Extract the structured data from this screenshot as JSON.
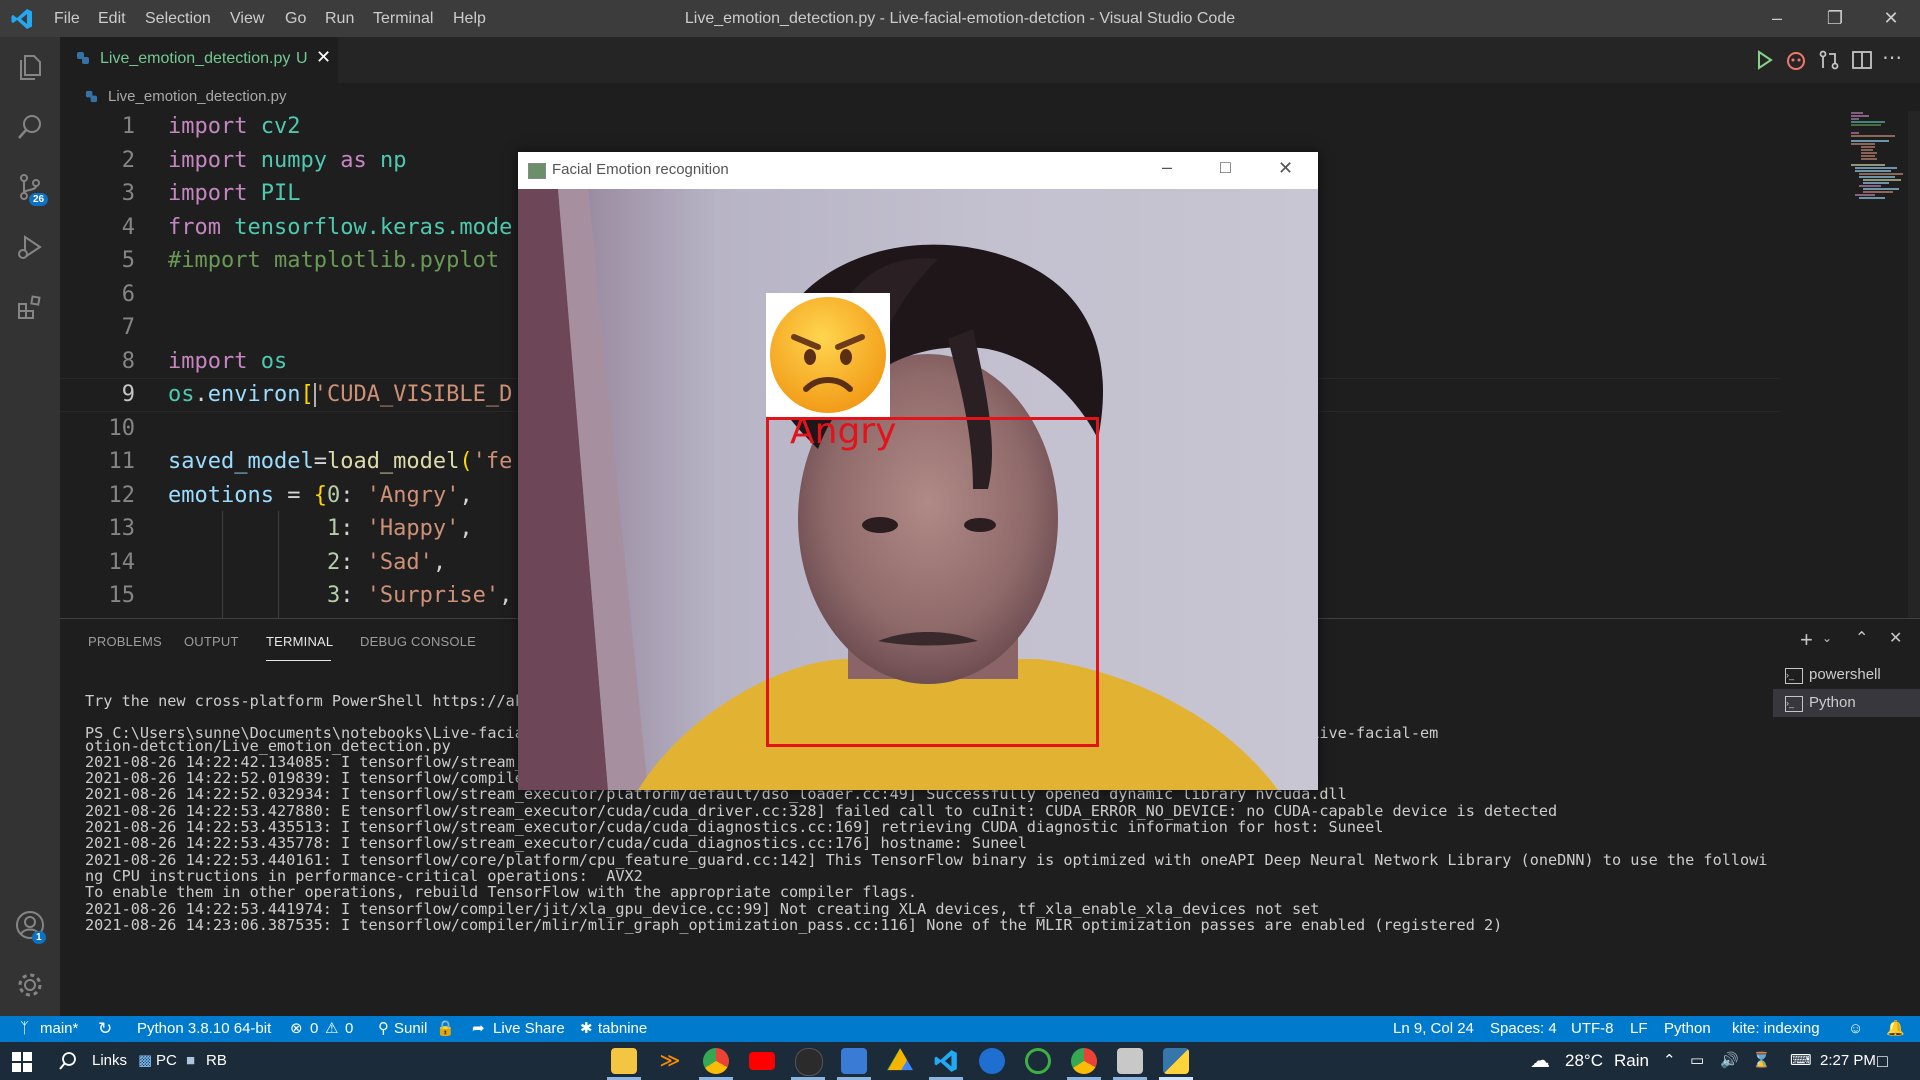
{
  "titlebar": {
    "menu": [
      "File",
      "Edit",
      "Selection",
      "View",
      "Go",
      "Run",
      "Terminal",
      "Help"
    ],
    "title": "Live_emotion_detection.py - Live-facial-emotion-detction - Visual Studio Code"
  },
  "activity": {
    "scm_badge": "26",
    "accounts_badge": "1"
  },
  "tab": {
    "filename": "Live_emotion_detection.py",
    "status": "U"
  },
  "breadcrumb": "Live_emotion_detection.py",
  "editor": {
    "lines": [
      "1",
      "2",
      "3",
      "4",
      "5",
      "6",
      "7",
      "8",
      "9",
      "10",
      "11",
      "12",
      "13",
      "14",
      "15"
    ],
    "code": [
      [
        {
          "t": "import",
          "c": "#c586c0"
        },
        {
          "t": " cv2",
          "c": "#4ec9b0"
        }
      ],
      [
        {
          "t": "import",
          "c": "#c586c0"
        },
        {
          "t": " numpy ",
          "c": "#4ec9b0"
        },
        {
          "t": "as",
          "c": "#c586c0"
        },
        {
          "t": " np",
          "c": "#4ec9b0"
        }
      ],
      [
        {
          "t": "import",
          "c": "#c586c0"
        },
        {
          "t": " PIL",
          "c": "#4ec9b0"
        }
      ],
      [
        {
          "t": "from",
          "c": "#c586c0"
        },
        {
          "t": " tensorflow.keras.mode",
          "c": "#4ec9b0"
        }
      ],
      [
        {
          "t": "#import matplotlib.pyplot",
          "c": "#6a9955"
        }
      ],
      [],
      [],
      [
        {
          "t": "import",
          "c": "#c586c0"
        },
        {
          "t": " os",
          "c": "#4ec9b0"
        }
      ],
      [
        {
          "t": "os",
          "c": "#4ec9b0"
        },
        {
          "t": ".",
          "c": "#d4d4d4"
        },
        {
          "t": "environ",
          "c": "#9cdcfe"
        },
        {
          "t": "[",
          "c": "#ffd700"
        },
        {
          "t": "'CUDA_VISIBLE_D",
          "c": "#ce9178"
        }
      ],
      [],
      [
        {
          "t": "saved_model",
          "c": "#9cdcfe"
        },
        {
          "t": "=",
          "c": "#d4d4d4"
        },
        {
          "t": "load_model",
          "c": "#dcdcaa"
        },
        {
          "t": "(",
          "c": "#ffd700"
        },
        {
          "t": "'fe",
          "c": "#ce9178"
        }
      ],
      [
        {
          "t": "emotions",
          "c": "#9cdcfe"
        },
        {
          "t": " = ",
          "c": "#d4d4d4"
        },
        {
          "t": "{",
          "c": "#ffd700"
        },
        {
          "t": "0",
          "c": "#b5cea8"
        },
        {
          "t": ": ",
          "c": "#d4d4d4"
        },
        {
          "t": "'Angry'",
          "c": "#ce9178"
        },
        {
          "t": ",",
          "c": "#d4d4d4"
        }
      ],
      [
        {
          "t": "            1",
          "c": "#b5cea8"
        },
        {
          "t": ": ",
          "c": "#d4d4d4"
        },
        {
          "t": "'Happy'",
          "c": "#ce9178"
        },
        {
          "t": ",",
          "c": "#d4d4d4"
        }
      ],
      [
        {
          "t": "            2",
          "c": "#b5cea8"
        },
        {
          "t": ": ",
          "c": "#d4d4d4"
        },
        {
          "t": "'Sad'",
          "c": "#ce9178"
        },
        {
          "t": ",",
          "c": "#d4d4d4"
        }
      ],
      [
        {
          "t": "            3",
          "c": "#b5cea8"
        },
        {
          "t": ": ",
          "c": "#d4d4d4"
        },
        {
          "t": "'Surprise'",
          "c": "#ce9178"
        },
        {
          "t": ",",
          "c": "#d4d4d4"
        }
      ]
    ]
  },
  "panel": {
    "tabs": [
      "PROBLEMS",
      "OUTPUT",
      "TERMINAL",
      "DEBUG CONSOLE"
    ],
    "active_tab": "TERMINAL",
    "terminals": [
      "powershell",
      "Python"
    ],
    "terminal_lines": [
      "Try the new cross-platform PowerShell https://ak",
      "",
      "PS C:\\Users\\sunne\\Documents\\notebooks\\Live-facia                                                     /Users/sunne/Documents/notebooks/Live-facial-em",
      "otion-detction/Live_emotion_detection.py",
      "2021-08-26 14:22:42.134085: I tensorflow/stream_                                                         110.dll",
      "2021-08-26 14:22:52.019839: I tensorflow/compiler/jit/xla_cpu_device.cc:41] Not creating XLA devices, tf_xla_enable_xla_devices not set",
      "2021-08-26 14:22:52.032934: I tensorflow/stream_executor/platform/default/dso_loader.cc:49] Successfully opened dynamic library nvcuda.dll",
      "2021-08-26 14:22:53.427880: E tensorflow/stream_executor/cuda/cuda_driver.cc:328] failed call to cuInit: CUDA_ERROR_NO_DEVICE: no CUDA-capable device is detected",
      "2021-08-26 14:22:53.435513: I tensorflow/stream_executor/cuda/cuda_diagnostics.cc:169] retrieving CUDA diagnostic information for host: Suneel",
      "2021-08-26 14:22:53.435778: I tensorflow/stream_executor/cuda/cuda_diagnostics.cc:176] hostname: Suneel",
      "2021-08-26 14:22:53.440161: I tensorflow/core/platform/cpu_feature_guard.cc:142] This TensorFlow binary is optimized with oneAPI Deep Neural Network Library (oneDNN) to use the followi",
      "ng CPU instructions in performance-critical operations:  AVX2",
      "To enable them in other operations, rebuild TensorFlow with the appropriate compiler flags.",
      "2021-08-26 14:22:53.441974: I tensorflow/compiler/jit/xla_gpu_device.cc:99] Not creating XLA devices, tf_xla_enable_xla_devices not set",
      "2021-08-26 14:23:06.387535: I tensorflow/compiler/mlir/mlir_graph_optimization_pass.cc:116] None of the MLIR optimization passes are enabled (registered 2)"
    ]
  },
  "popup": {
    "title": "Facial Emotion recognition",
    "emotion_label": "Angry",
    "box_color": "#e3131b"
  },
  "statusbar": {
    "branch": "main*",
    "python": "Python 3.8.10 64-bit",
    "errors": "0",
    "warnings": "0",
    "user": "Sunil",
    "liveshare": "Live Share",
    "tabnine": "tabnine",
    "cursor": "Ln 9, Col 24",
    "spaces": "Spaces: 4",
    "encoding": "UTF-8",
    "eol": "LF",
    "language": "Python",
    "kite": "kite: indexing"
  },
  "taskbar": {
    "links": "Links",
    "pc": "PC",
    "rb": "RB",
    "temperature": "28°C",
    "weather": "Rain",
    "time": "2:27 PM"
  },
  "colors": {
    "accent": "#007acc",
    "titlebar": "#3c3c3c",
    "activitybar": "#333333"
  }
}
